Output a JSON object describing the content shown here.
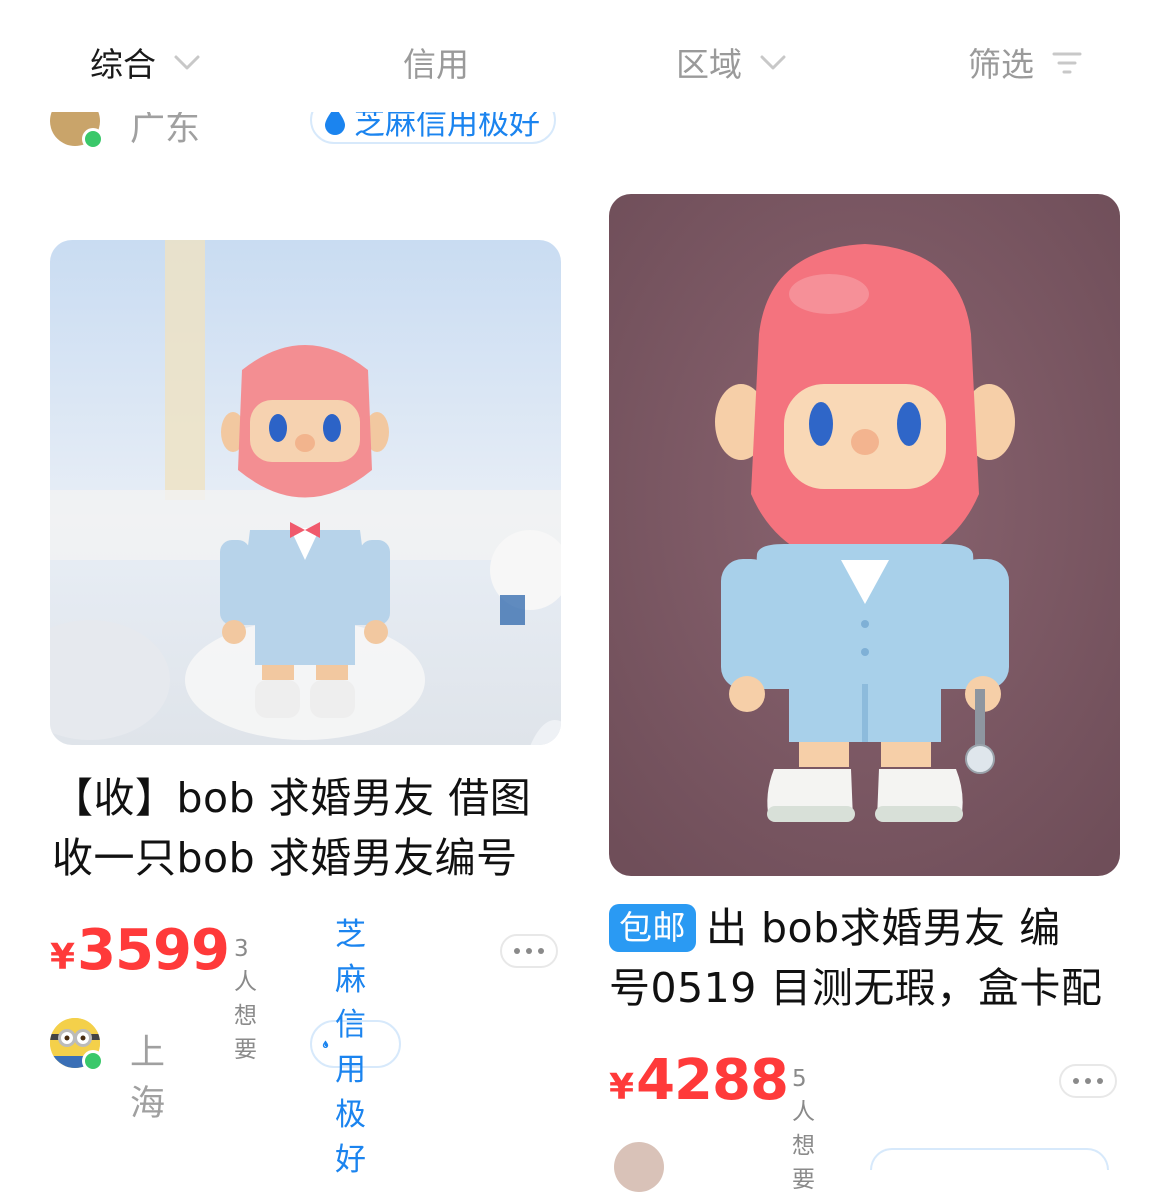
{
  "filter_bar": {
    "items": [
      {
        "label": "综合",
        "active": true,
        "icon": "chevron-down-icon"
      },
      {
        "label": "信用",
        "active": false,
        "icon": ""
      },
      {
        "label": "区域",
        "active": false,
        "icon": "chevron-down-icon"
      },
      {
        "label": "筛选",
        "active": false,
        "icon": "filter-icon"
      }
    ]
  },
  "partial_top_left": {
    "city": "广东",
    "credit_label": "芝麻信用极好"
  },
  "listings": [
    {
      "title_line1": "【收】bob 求婚男友 借图",
      "title_line2": "收一只bob 求婚男友编号",
      "currency": "¥",
      "price": "3599",
      "wants": "3人想要",
      "city": "上海",
      "credit_label": "芝麻信用极好",
      "tag": ""
    },
    {
      "tag": "包邮",
      "title_line1": "出 bob求婚男友 编",
      "title_line2": "号0519 目测无瑕，盒卡配",
      "currency": "¥",
      "price": "4288",
      "wants": "5人想要"
    }
  ],
  "colors": {
    "price": "#ff3a3a",
    "credit": "#1b84ef",
    "tag_bg": "#2a9af3",
    "online": "#3ac86a"
  }
}
